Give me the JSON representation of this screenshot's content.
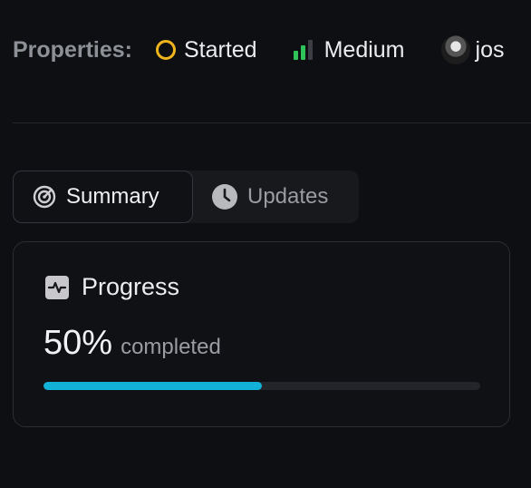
{
  "properties": {
    "label": "Properties:",
    "status": {
      "label": "Started",
      "color": "#f0b41c",
      "icon": "circle-outline-icon"
    },
    "priority": {
      "label": "Medium",
      "icon": "signal-bars-icon",
      "filled_bars": 2,
      "total_bars": 3,
      "color": "#2fc45a"
    },
    "assignee": {
      "label": "jos",
      "icon": "avatar"
    }
  },
  "tabs": [
    {
      "label": "Summary",
      "icon": "target-icon",
      "active": true
    },
    {
      "label": "Updates",
      "icon": "clock-icon",
      "active": false
    }
  ],
  "progress_card": {
    "title": "Progress",
    "icon": "pulse-icon",
    "percent_text": "50%",
    "completed_label": "completed",
    "fraction": 0.5,
    "bar_color": "#12b2d8"
  }
}
